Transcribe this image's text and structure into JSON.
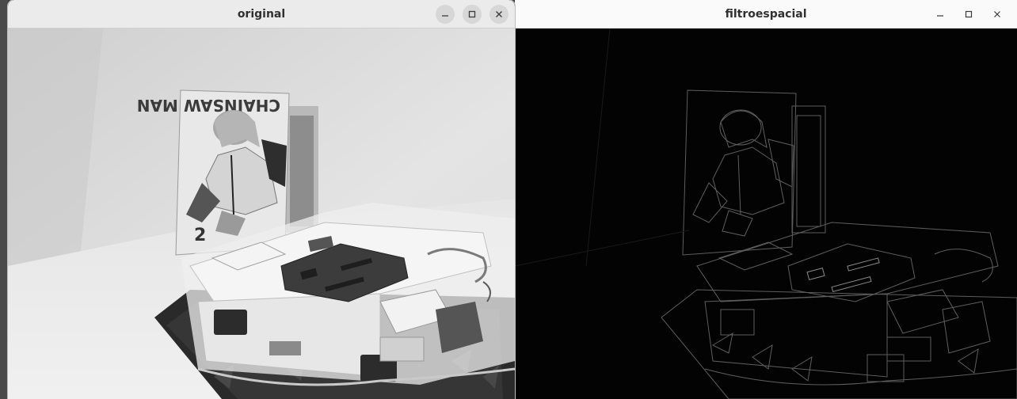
{
  "windows": {
    "original": {
      "title": "original",
      "controls": [
        "minimize-icon",
        "maximize-icon",
        "close-icon"
      ]
    },
    "filter": {
      "title": "filtroespacial",
      "controls": [
        "minimize-icon",
        "maximize-icon",
        "close-icon"
      ]
    }
  },
  "scene": {
    "book_cover_text": "CHAINSAW MAN",
    "book_volume": "2"
  },
  "colors": {
    "titlebar_active": "#ebebeb",
    "titlebar_inactive": "#fafafa",
    "filter_background": "#030303",
    "edge_lines": "#8a8a8a"
  }
}
